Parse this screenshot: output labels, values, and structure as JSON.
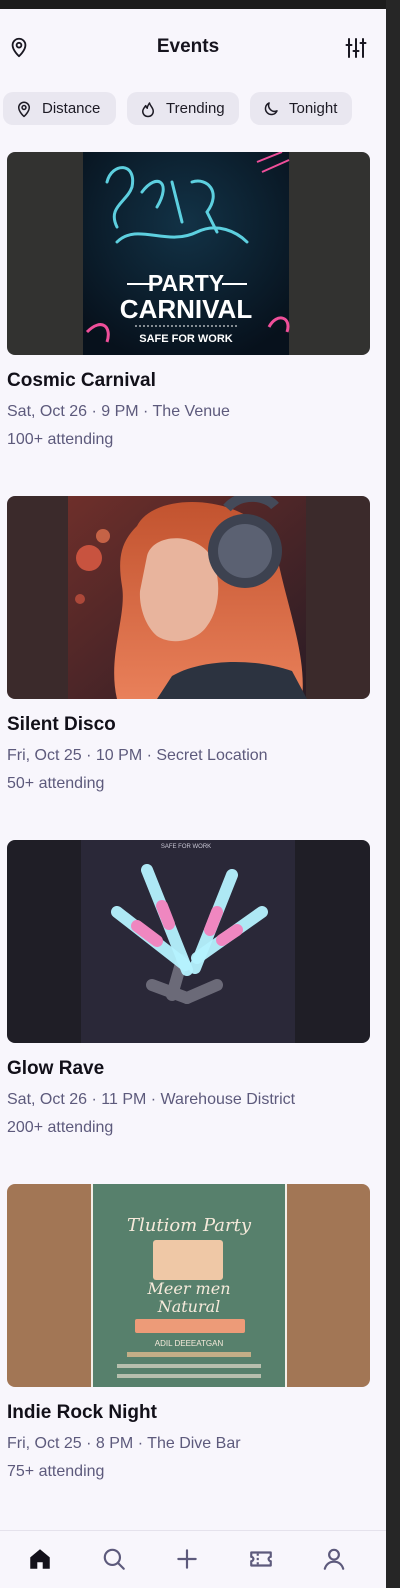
{
  "header": {
    "title": "Events",
    "location_icon": "location-pin-icon",
    "filter_icon": "sliders-icon"
  },
  "chips": [
    {
      "label": "Distance",
      "icon": "location-pin-icon"
    },
    {
      "label": "Trending",
      "icon": "flame-icon"
    },
    {
      "label": "Tonight",
      "icon": "moon-icon"
    }
  ],
  "events": [
    {
      "name": "Cosmic Carnival",
      "meta": "Sat, Oct 26 · 9 PM · The Venue",
      "attending": "100+ attending",
      "poster": {
        "line1": "PARTY",
        "line2": "CARNIVAL",
        "line3": "SAFE FOR WORK"
      }
    },
    {
      "name": "Silent Disco",
      "meta": "Fri, Oct 25 · 10 PM · Secret Location",
      "attending": "50+ attending"
    },
    {
      "name": "Glow Rave",
      "meta": "Sat, Oct 26 · 11 PM · Warehouse District",
      "attending": "200+ attending",
      "poster": {
        "top_text": "SAFE FOR WORK"
      }
    },
    {
      "name": "Indie Rock Night",
      "meta": "Fri, Oct 25 · 8 PM · The Dive Bar",
      "attending": "75+ attending",
      "poster": {
        "line1": "Tlutiom Party",
        "line2": "Meer men",
        "line3": "Natural",
        "line4": "ADIL DEEEATGAN"
      }
    }
  ],
  "nav": {
    "items": [
      "home-icon",
      "search-icon",
      "plus-icon",
      "ticket-icon",
      "profile-icon"
    ],
    "active": "home-icon"
  },
  "colors": {
    "background": "#f8f6fc",
    "chip_bg": "#e9e7f0",
    "meta_text": "#5d5a7c",
    "title_text": "#16141e"
  }
}
